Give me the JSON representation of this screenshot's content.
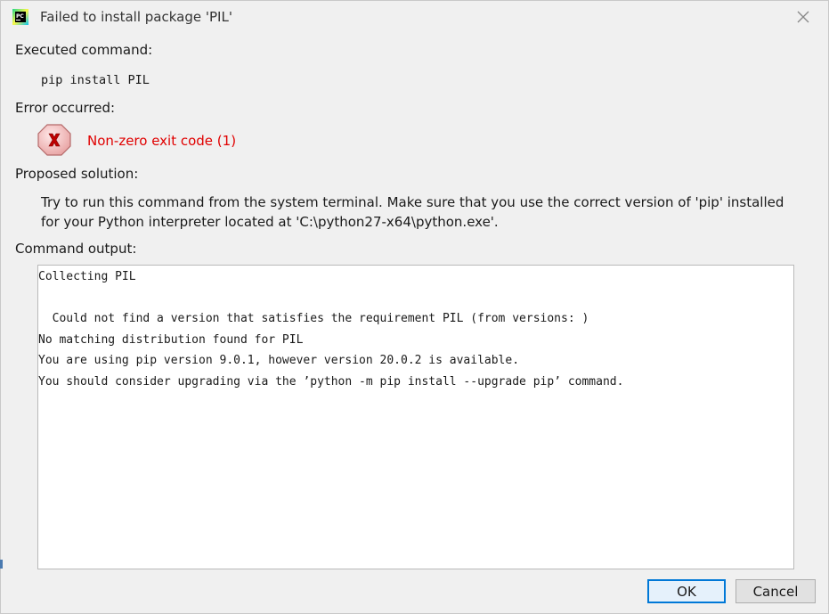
{
  "window": {
    "title": "Failed to install package 'PIL'",
    "app_icon_label": "PC"
  },
  "sections": {
    "executed_label": "Executed command:",
    "command": "pip install PIL",
    "error_label": "Error occurred:",
    "error_message": "Non-zero exit code (1)",
    "solution_label": "Proposed solution:",
    "solution_text": "Try to run this command from the system terminal. Make sure that you use the correct version of 'pip' installed for your Python interpreter located at 'C:\\python27-x64\\python.exe'.",
    "output_label": "Command output:"
  },
  "output_lines": [
    "Collecting PIL",
    "",
    "  Could not find a version that satisfies the requirement PIL (from versions: )",
    "No matching distribution found for PIL",
    "You are using pip version 9.0.1, however version 20.0.2 is available.",
    "You should consider upgrading via the ’python -m pip install --upgrade pip’ command."
  ],
  "buttons": {
    "ok": "OK",
    "cancel": "Cancel"
  },
  "colors": {
    "error_text": "#e00000",
    "focus_border": "#0078d7",
    "background": "#f0f0f0"
  },
  "icons": {
    "app": "pycharm-icon",
    "close": "close-icon",
    "error": "error-x-icon"
  }
}
